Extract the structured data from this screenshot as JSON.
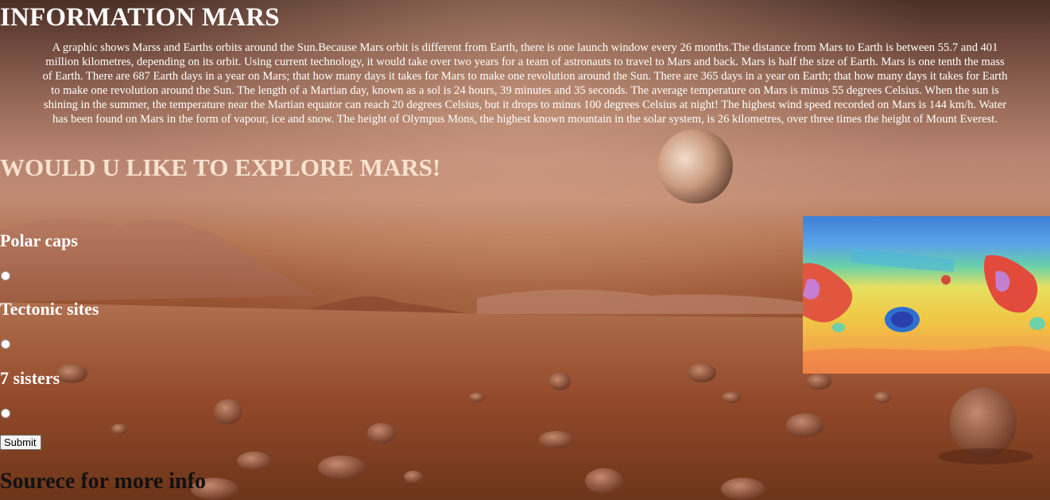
{
  "header": {
    "title": "INFORMATION MARS"
  },
  "intro": {
    "lines": [
      "A graphic shows Marss and Earths orbits around the Sun.Because Mars orbit is different from Earth, there is one launch window every 26 months.The distance from Mars to Earth is between 55.7 and 401",
      "million kilometres, depending on its orbit. Using current technology, it would take over two years for a team of astronauts to travel to Mars and back. Mars is half the size of Earth. Mars is one tenth the mass",
      "of Earth. There are 687 Earth days in a year on Mars; that how many days it takes for Mars to make one revolution around the Sun. There are 365 days in a year on Earth; that how many days it takes for Earth",
      "to make one revolution around the Sun. The length of a Martian day, known as a sol is 24 hours, 39 minutes and 35 seconds. The average temperature on Mars is minus 55 degrees Celsius. When the sun is",
      "shining in the summer, the temperature near the Martian equator can reach 20 degrees Celsius, but it drops to minus 100 degrees Celsius at night! The highest wind speed recorded on Mars is 144 km/h. Water",
      "has been found on Mars in the form of vapour, ice and snow. The height of Olympus Mons, the highest known mountain in the solar system, is 26 kilometres, over three times the height of Mount Everest."
    ]
  },
  "explore": {
    "heading": "WOULD U LIKE TO EXPLORE MARS!"
  },
  "options": [
    {
      "label": "Polar caps",
      "checked": false
    },
    {
      "label": "Tectonic sites",
      "checked": false
    },
    {
      "label": "7 sisters",
      "checked": false
    }
  ],
  "form": {
    "submit_label": "Submit"
  },
  "source": {
    "heading": "Sourece for more info"
  },
  "colors": {
    "heading_text": "#ffffff",
    "explore_text": "#f7e3cf",
    "source_text": "#111111"
  }
}
